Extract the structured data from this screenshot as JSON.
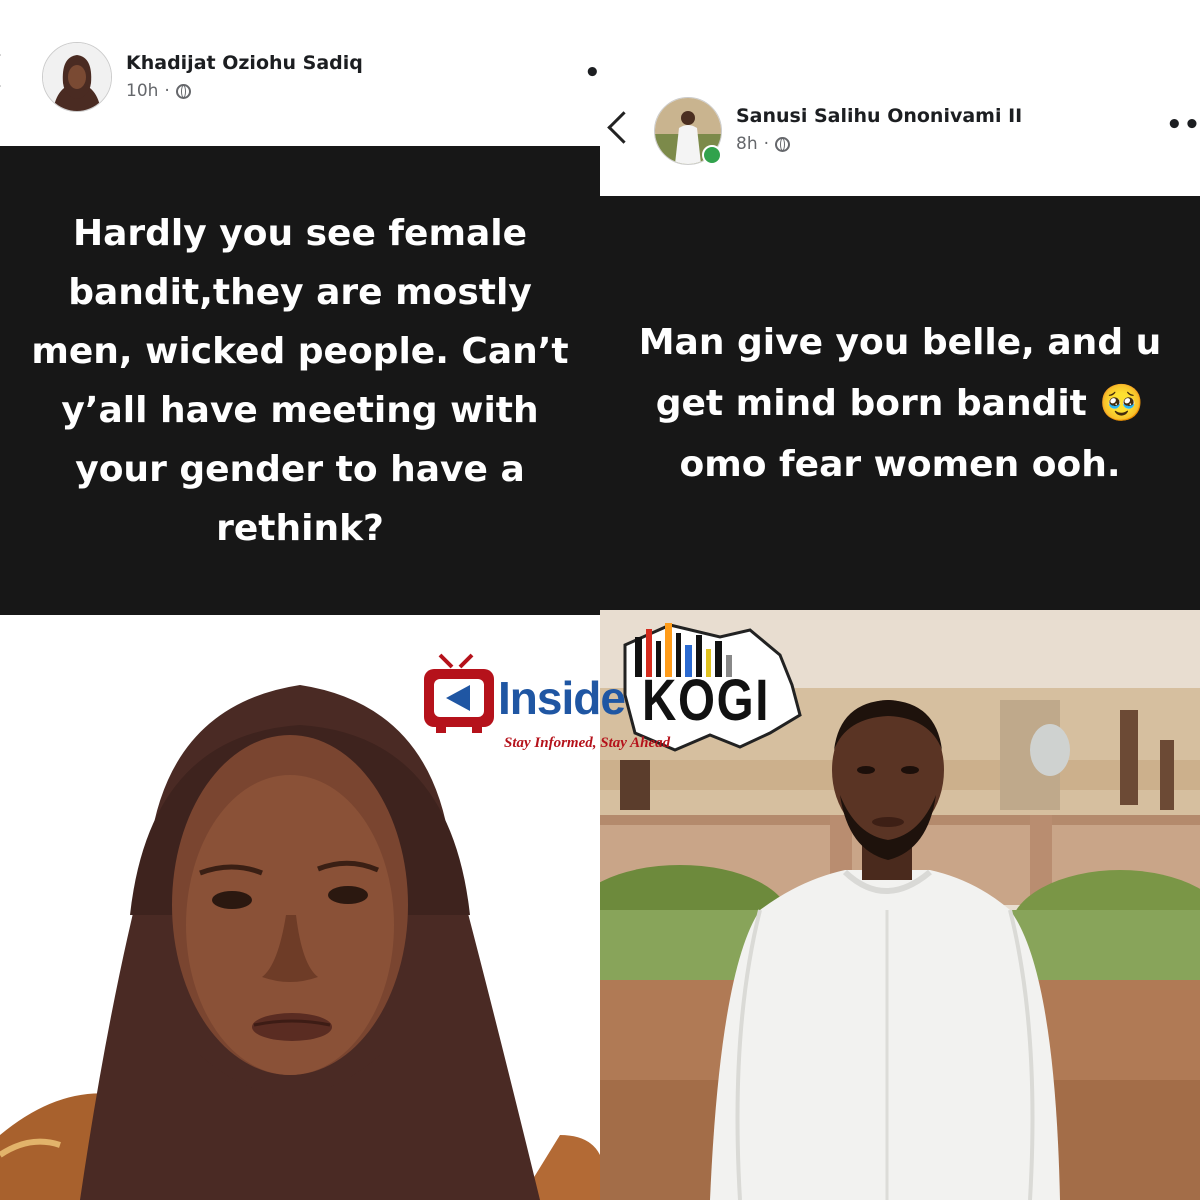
{
  "left_post": {
    "author": "Khadijat Oziohu Sadiq",
    "time": "10h",
    "dot": "·",
    "text": "Hardly you see female bandit,they are mostly men, wicked people. Can’t y’all have meeting with your gender to have a rethink?"
  },
  "right_post": {
    "author": "Sanusi Salihu Ononivami II",
    "time": "8h",
    "dot": "·",
    "text": "Man give you belle, and u get mind born bandit 🥹 omo fear women ooh."
  },
  "menu_glyph": "•••",
  "logo": {
    "brand_left": "Inside",
    "brand_right": "KOGI",
    "tagline": "Stay Informed, Stay Ahead"
  },
  "colors": {
    "text_block": "#171717",
    "logo_blue": "#1f56a3",
    "logo_red": "#b5121b",
    "online_green": "#31a24c"
  },
  "icons": [
    "back-arrow-icon",
    "globe-icon",
    "more-options-icon",
    "tv-logo-icon",
    "online-status-icon"
  ]
}
